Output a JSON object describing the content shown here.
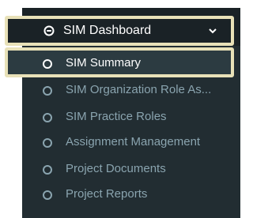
{
  "sidebar": {
    "header": {
      "label": "SIM Dashboard",
      "icon": "dashboard-icon",
      "expand_icon": "chevron-down-icon"
    },
    "items": [
      {
        "label": "SIM Summary",
        "active": true,
        "icon": "circle-icon"
      },
      {
        "label": "SIM Organization Role As...",
        "active": false,
        "icon": "circle-icon"
      },
      {
        "label": "SIM Practice Roles",
        "active": false,
        "icon": "circle-icon"
      },
      {
        "label": "Assignment Management",
        "active": false,
        "icon": "circle-icon"
      },
      {
        "label": "Project Documents",
        "active": false,
        "icon": "circle-icon"
      },
      {
        "label": "Project Reports",
        "active": false,
        "icon": "circle-icon"
      }
    ]
  },
  "colors": {
    "sidebar_bg": "#222d32",
    "sidebar_header_bg": "#1a2226",
    "active_bg": "#2c3b41",
    "inactive_text": "#8aa4af",
    "active_text": "#ffffff",
    "highlight_outline": "#e8e1b8"
  }
}
